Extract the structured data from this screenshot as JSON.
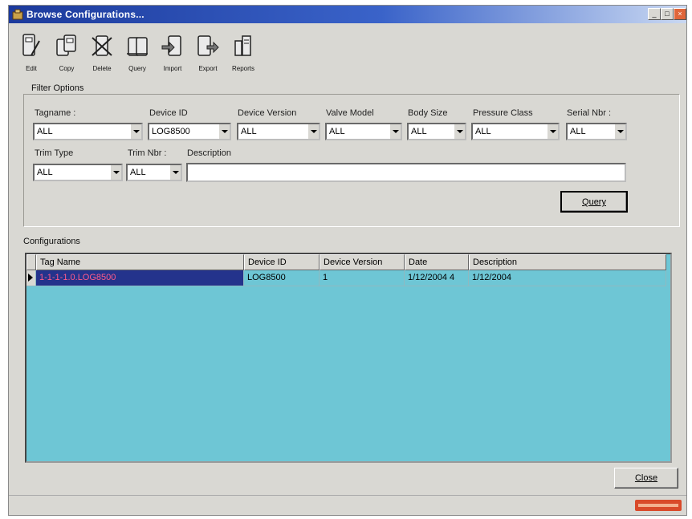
{
  "window": {
    "title": "Browse Configurations...",
    "controls": {
      "minimize": "_",
      "maximize": "□",
      "close": "×"
    }
  },
  "toolbar": {
    "items": [
      {
        "label": "Edit",
        "icon": "edit-icon"
      },
      {
        "label": "Copy",
        "icon": "copy-icon"
      },
      {
        "label": "Delete",
        "icon": "delete-icon"
      },
      {
        "label": "Query",
        "icon": "query-icon"
      },
      {
        "label": "Import",
        "icon": "import-icon"
      },
      {
        "label": "Export",
        "icon": "export-icon"
      },
      {
        "label": "Reports",
        "icon": "reports-icon"
      }
    ]
  },
  "filter": {
    "legend": "Filter Options",
    "tagname": {
      "label": "Tagname :",
      "value": "ALL"
    },
    "device_id": {
      "label": "Device ID",
      "value": "LOG8500"
    },
    "device_version": {
      "label": "Device Version",
      "value": "ALL"
    },
    "valve_model": {
      "label": "Valve Model",
      "value": "ALL"
    },
    "body_size": {
      "label": "Body Size",
      "value": "ALL"
    },
    "pressure_class": {
      "label": "Pressure Class",
      "value": "ALL"
    },
    "serial_nbr": {
      "label": "Serial Nbr :",
      "value": "ALL"
    },
    "trim_type": {
      "label": "Trim Type",
      "value": "ALL"
    },
    "trim_nbr": {
      "label": "Trim Nbr :",
      "value": "ALL"
    },
    "description": {
      "label": "Description",
      "value": ""
    },
    "query_button": "Query"
  },
  "configurations": {
    "legend": "Configurations",
    "columns": [
      "Tag Name",
      "Device ID",
      "Device Version",
      "Date",
      "Description"
    ],
    "rows": [
      [
        "1-1-1-1.0.LOG8500",
        "LOG8500",
        "1",
        "1/12/2004 4",
        "1/12/2004"
      ]
    ]
  },
  "close_button": "Close",
  "colors": {
    "title_start": "#1c3a9c",
    "window_bg": "#d9d8d3",
    "grid_bg": "#6ec6d5",
    "selection": "#24338c"
  }
}
